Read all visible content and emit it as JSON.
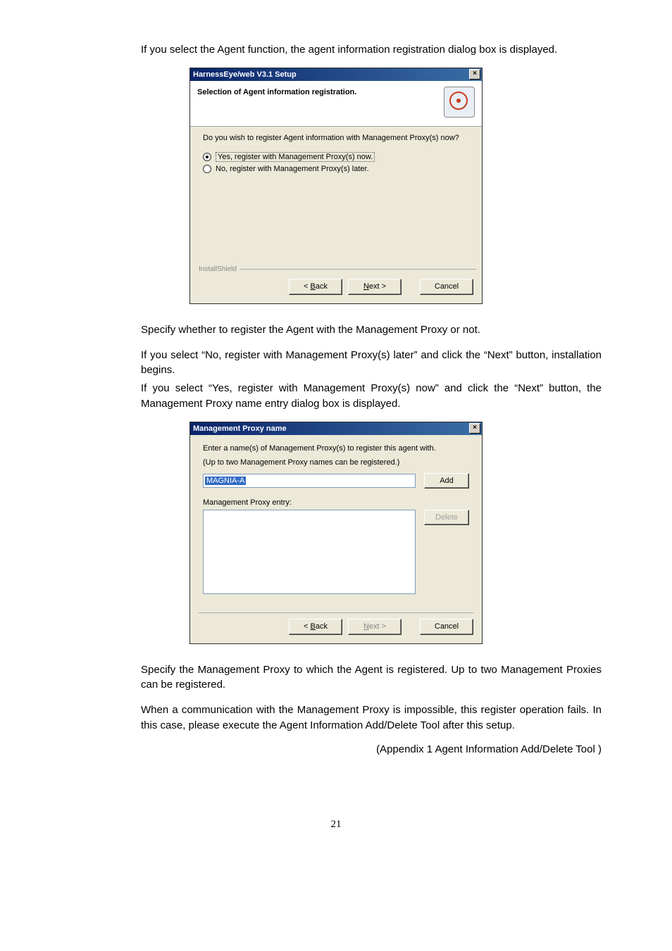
{
  "body": {
    "intro": "If you select the Agent function, the agent information registration dialog box is displayed.",
    "specify_register": "Specify whether to register the Agent with the Management Proxy or not.",
    "if_no": "If you select “No, register with Management Proxy(s) later” and click the “Next” button, installation begins.",
    "if_yes": "If you select “Yes, register with Management Proxy(s) now” and click the “Next” button, the Management Proxy name entry dialog box is displayed.",
    "specify_proxy": "Specify the Management Proxy to which the Agent is registered. Up to two Management Proxies can be registered.",
    "comm_fail": "When a communication with the Management Proxy is impossible, this register operation fails. In this case, please execute the Agent Information Add/Delete Tool after this setup.",
    "appendix": "(Appendix 1 Agent Information Add/Delete Tool )",
    "page_number": "21"
  },
  "dialog1": {
    "title": "HarnessEye/web V3.1 Setup",
    "heading": "Selection of Agent information registration.",
    "question": "Do you wish to register Agent information with Management Proxy(s) now?",
    "option_yes": "Yes, register with Management Proxy(s) now.",
    "option_no": "No, register with Management Proxy(s) later.",
    "fieldset": "InstallShield",
    "back": "< Back",
    "next": "Next >",
    "cancel": "Cancel"
  },
  "dialog2": {
    "title": "Management Proxy name",
    "instr1": "Enter a name(s) of Management Proxy(s) to register this agent with.",
    "instr2": "(Up to two Management Proxy names can be registered.)",
    "input_value": "MAGNIA-A",
    "add": "Add",
    "list_label": "Management Proxy entry:",
    "delete": "Delete",
    "back": "< Back",
    "next": "Next >",
    "cancel": "Cancel"
  }
}
